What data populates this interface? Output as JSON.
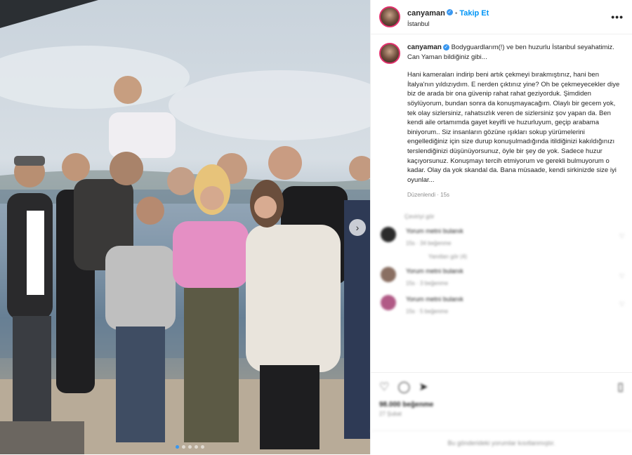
{
  "post": {
    "username": "canyaman",
    "follow_label": "Takip Et",
    "location": "İstanbul",
    "more_icon": "more-horizontal-icon",
    "caption_intro": "Bodyguardlarım(!) ve ben huzurlu İstanbul seyahatimiz. Can Yaman bildiğiniz gibi...",
    "caption_body": "Hani kameraları indirip beni artık çekmeyi bırakmıştınız, hani ben İtalya'nın yıldızıydım. E nerden çıktınız yine? Oh be çekmeyecekler diye biz de arada bir ona güvenip rahat rahat geziyorduk. Şimdiden söylüyorum, bundan sonra da konuşmayacağım. Olaylı bir gecem yok, tek olay sizlersiniz, rahatsızlık veren de sizlersiniz şov yapan da. Ben kendi aile ortamımda gayet keyifli ve huzurluyum, geçip arabama biniyorum.. Siz insanların gözüne ışıkları sokup yürümelerini engellediğiniz için size durup konuşulmadığında itildiğinizi kakıldığınızı terslendiğinizi düşünüyorsunuz, öyle bir şey de yok. Sadece huzur kaçıyorsunuz. Konuşmayı tercih etmiyorum ve gerekli bulmuyorum o kadar. Olay da yok skandal da. Bana müsaade, kendi sirkinizde size iyi oyunlar...",
    "edited_label": "Düzenlendi · 15s"
  },
  "comments": {
    "see_translation": "Çeviriyi gör",
    "items": [
      {
        "text": "Yorum metni bulanık",
        "meta": "15s · 34 beğenme"
      },
      {
        "text": "Yorum metni bulanık",
        "meta": "15s · 3 beğenme"
      },
      {
        "text": "Yorum metni bulanık",
        "meta": "15s · 5 beğenme"
      }
    ],
    "replies_label": "Yanıtları gör (4)"
  },
  "actions": {
    "likes": "98.000 beğenme",
    "date": "27 Şubat",
    "add_comment_placeholder": "Bu gönderideki yorumlar kısıtlanmıştır."
  },
  "colors": {
    "accent": "#0095f6",
    "verified": "#3897f0"
  }
}
